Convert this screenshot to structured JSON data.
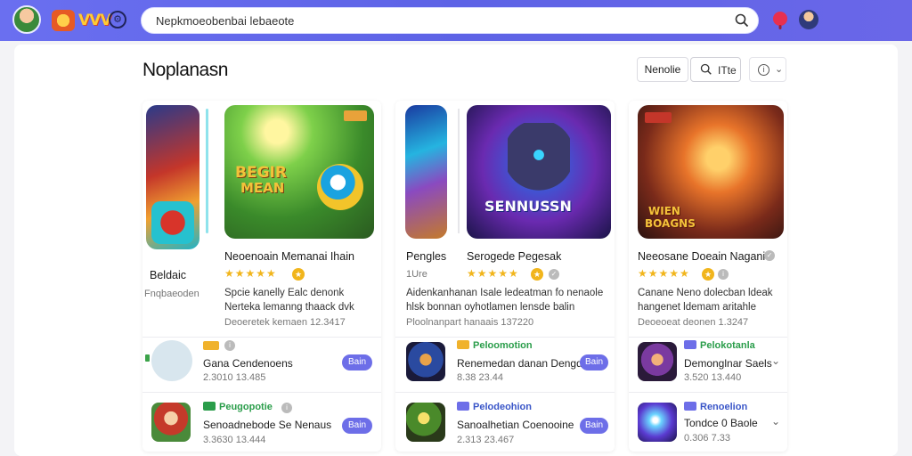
{
  "header": {
    "logo_text": "VVV",
    "search_value": "Nepkmoeobenbai lebaeote"
  },
  "page": {
    "title": "Noplanasn",
    "filter_label": "Nenolie",
    "sort_label": "ITte"
  },
  "columns": [
    {
      "featured": {
        "side_title": "Beldaic",
        "side_sub": "Fnqbaeoden",
        "art_caption_a": "BEGIR",
        "art_caption_b": "MEAN",
        "title": "Neoenoain Memanai Ihain",
        "description_lines": [
          "Spcie kanelly Ealc denonk",
          "Nerteka lemanng thaack dvk"
        ],
        "meta": "Deoeretek kemaen 12.3417"
      },
      "items": [
        {
          "tag": "",
          "name": "Gana Cendenoens",
          "meta": "2.3010 13.485",
          "button": "Bain"
        },
        {
          "tag": "Peugopotie",
          "name": "Senoadnebode Se Nenaus",
          "meta": "3.3630 13.444",
          "button": "Bain"
        }
      ]
    },
    {
      "featured": {
        "side_title": "Pengles",
        "side_sub": "1Ure",
        "art_caption": "SENNUSSN",
        "title": "Serogede Pegesak",
        "description_lines": [
          "Aidenkanhanan Isale ledeatman fo nenaole",
          "hlsk bonnan oyhotlamen lensde balin"
        ],
        "meta": "Ploolnanpart hanaais 137220"
      },
      "items": [
        {
          "tag": "Peloomotion",
          "name": "Renemedan danan Dengdan",
          "meta": "8.38 23.44",
          "button": "Bain"
        },
        {
          "tag": "Pelodeohion",
          "name": "Sanoalhetian Coenooine",
          "meta": "2.313 23.467",
          "button": "Bain"
        }
      ]
    },
    {
      "featured": {
        "art_caption_a": "WIEN",
        "art_caption_b": "BOAGNS",
        "title": "Neeosane Doeain Nagani",
        "description_lines": [
          "Canane Neno dolecban ldeak",
          "hangenet ldemam aritahle"
        ],
        "meta": "Deoeoeat deonen 1.3247"
      },
      "items": [
        {
          "tag": "Pelokotanla",
          "name": "Demonglnar Saels",
          "meta": "3.520 13.440"
        },
        {
          "tag": "Renoelion",
          "name": "Tondce 0 Baole",
          "meta": "0.306 7.33"
        }
      ]
    }
  ]
}
